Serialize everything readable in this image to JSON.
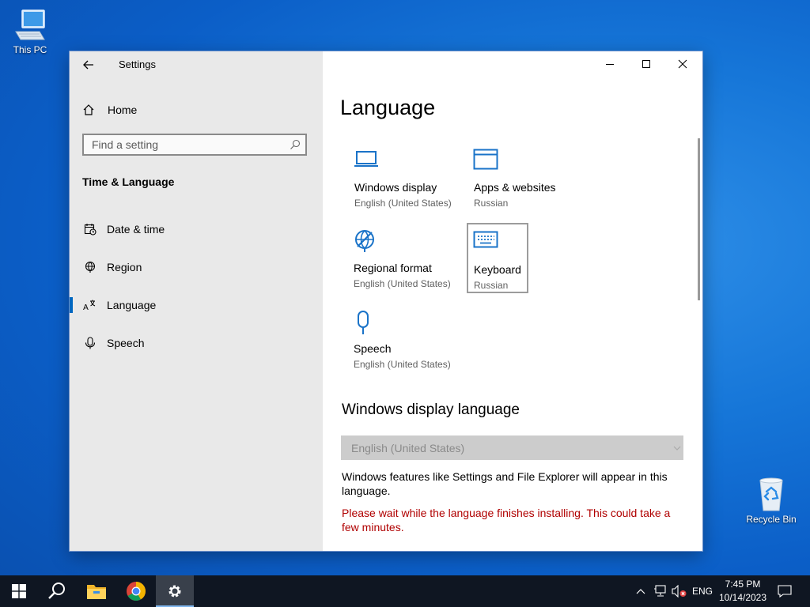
{
  "desktop": {
    "this_pc_label": "This PC",
    "recycle_bin_label": "Recycle Bin"
  },
  "window": {
    "title": "Settings",
    "sidebar": {
      "home_label": "Home",
      "search_placeholder": "Find a setting",
      "section_title": "Time & Language",
      "items": [
        {
          "label": "Date & time",
          "icon": "calendar-clock-icon"
        },
        {
          "label": "Region",
          "icon": "globe-icon"
        },
        {
          "label": "Language",
          "icon": "language-icon",
          "active": true
        },
        {
          "label": "Speech",
          "icon": "microphone-icon"
        }
      ]
    },
    "content": {
      "page_title": "Language",
      "tiles": [
        {
          "name": "Windows display",
          "sub": "English (United States)",
          "icon": "laptop-icon"
        },
        {
          "name": "Apps & websites",
          "sub": "Russian",
          "icon": "app-window-icon"
        },
        {
          "name": "Regional format",
          "sub": "English (United States)",
          "icon": "globe-format-icon"
        },
        {
          "name": "Keyboard",
          "sub": "Russian",
          "icon": "keyboard-icon"
        },
        {
          "name": "Speech",
          "sub": "English (United States)",
          "icon": "microphone-icon"
        }
      ],
      "display_language_title": "Windows display language",
      "display_language_value": "English (United States)",
      "description": "Windows features like Settings and File Explorer will appear in this language.",
      "warning": "Please wait while the language finishes installing. This could take a few minutes."
    }
  },
  "taskbar": {
    "language": "ENG",
    "time": "7:45 PM",
    "date": "10/14/2023"
  },
  "colors": {
    "accent": "#0067c0",
    "warning": "#b00000",
    "icon_blue": "#1a73c8"
  }
}
